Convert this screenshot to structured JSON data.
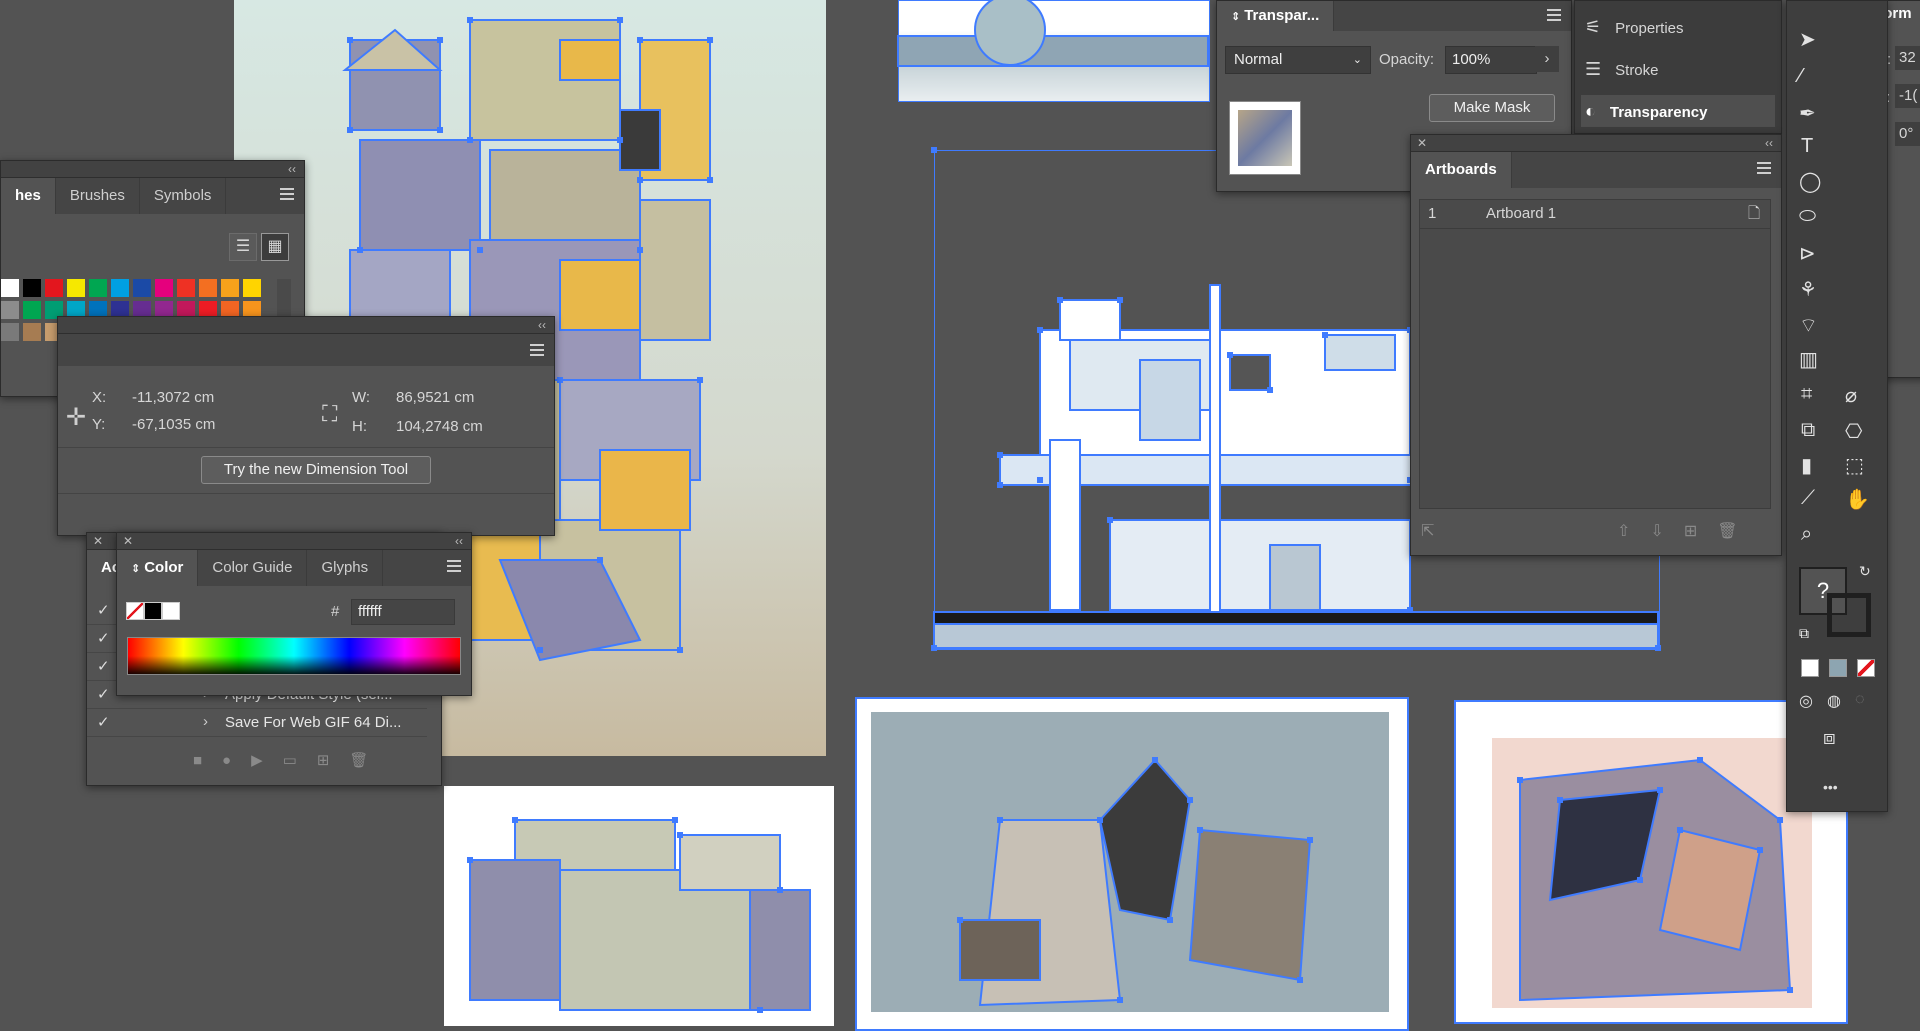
{
  "colors": {
    "workspace": "#535353",
    "panel": "#535353",
    "selection": "#3f7bff"
  },
  "swatches_panel": {
    "tabs": [
      "hes",
      "Brushes",
      "Symbols"
    ],
    "swatch_row1": [
      "#ffffff",
      "#000000",
      "#e3161e",
      "#f6e800",
      "#00a651",
      "#00a0e3",
      "#1b4aa6",
      "#e5007d",
      "#ee3124",
      "#f36f21",
      "#f7a21b",
      "#ffd400"
    ],
    "swatch_row2": [
      "#8c8c8c",
      "#00a651",
      "#009d73",
      "#00a6c7",
      "#0072bc",
      "#2e3192",
      "#662d91",
      "#92278f",
      "#c2185b",
      "#ed1c24",
      "#f26522",
      "#f7941d"
    ],
    "swatch_row3": [
      "#7a7a7a",
      "#a67c52",
      "#c69c6d",
      "#8c6239",
      "#754c24",
      "#603913",
      "#f5d6a6",
      "#d9d9d9",
      "#ffde59",
      "#bfbfbf",
      "#9ad17f",
      "#d9a56a"
    ]
  },
  "transform_mini": {
    "x_label": "X:",
    "x_value": "-11,3072 cm",
    "y_label": "Y:",
    "y_value": "-67,1035 cm",
    "w_label": "W:",
    "w_value": "86,9521 cm",
    "h_label": "H:",
    "h_value": "104,2748 cm",
    "try_button": "Try the new Dimension Tool"
  },
  "color_panel": {
    "tabs": [
      "Color",
      "Color Guide",
      "Glyphs"
    ],
    "hex_symbol": "#",
    "hex_value": "ffffff"
  },
  "actions_panel": {
    "tab": "Ac",
    "rows": [
      "",
      "",
      "",
      "Apply Default Style (sel...",
      "Save For Web GIF 64 Di..."
    ]
  },
  "transparency_panel": {
    "tab": "Transpar...",
    "blend_mode": "Normal",
    "opacity_label": "Opacity:",
    "opacity_value": "100%",
    "make_mask": "Make Mask"
  },
  "properties_dock": {
    "items": [
      "Properties",
      "Stroke",
      "Transparency"
    ]
  },
  "artboards_panel": {
    "tab": "Artboards",
    "rows": [
      {
        "num": "1",
        "name": "Artboard 1"
      }
    ]
  },
  "transform_panel": {
    "tab": "Transform",
    "x_label": "X:",
    "x_value": "32",
    "y_label": "Y:",
    "y_value": "-1(",
    "angle_value": "0°"
  },
  "toolbar": {
    "question": "?",
    "more": "•••"
  }
}
